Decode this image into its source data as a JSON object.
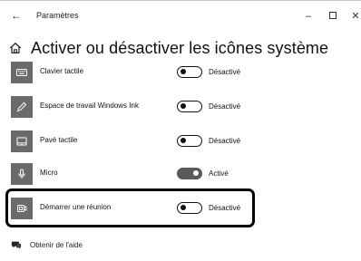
{
  "window": {
    "app_title": "Paramètres",
    "back_glyph": "←",
    "minimize_glyph": "–",
    "close_glyph": "✕"
  },
  "page": {
    "title": "Activer ou désactiver les icônes système"
  },
  "items": [
    {
      "label": "Clavier tactile",
      "state": "Désactivé",
      "on": false,
      "icon": "keyboard-icon"
    },
    {
      "label": "Espace de travail Windows Ink",
      "state": "Désactivé",
      "on": false,
      "icon": "pen-icon"
    },
    {
      "label": "Pavé tactile",
      "state": "Désactivé",
      "on": false,
      "icon": "touchpad-icon"
    },
    {
      "label": "Micro",
      "state": "Activé",
      "on": true,
      "icon": "microphone-icon"
    },
    {
      "label": "Démarrer une réunion",
      "state": "Désactivé",
      "on": false,
      "icon": "meet-now-icon"
    }
  ],
  "help": {
    "label": "Obtenir de l'aide",
    "icon": "help-chat-icon"
  },
  "colors": {
    "tile": "#6b6b6b",
    "toggle_on": "#595959",
    "highlight_border": "#000000"
  }
}
